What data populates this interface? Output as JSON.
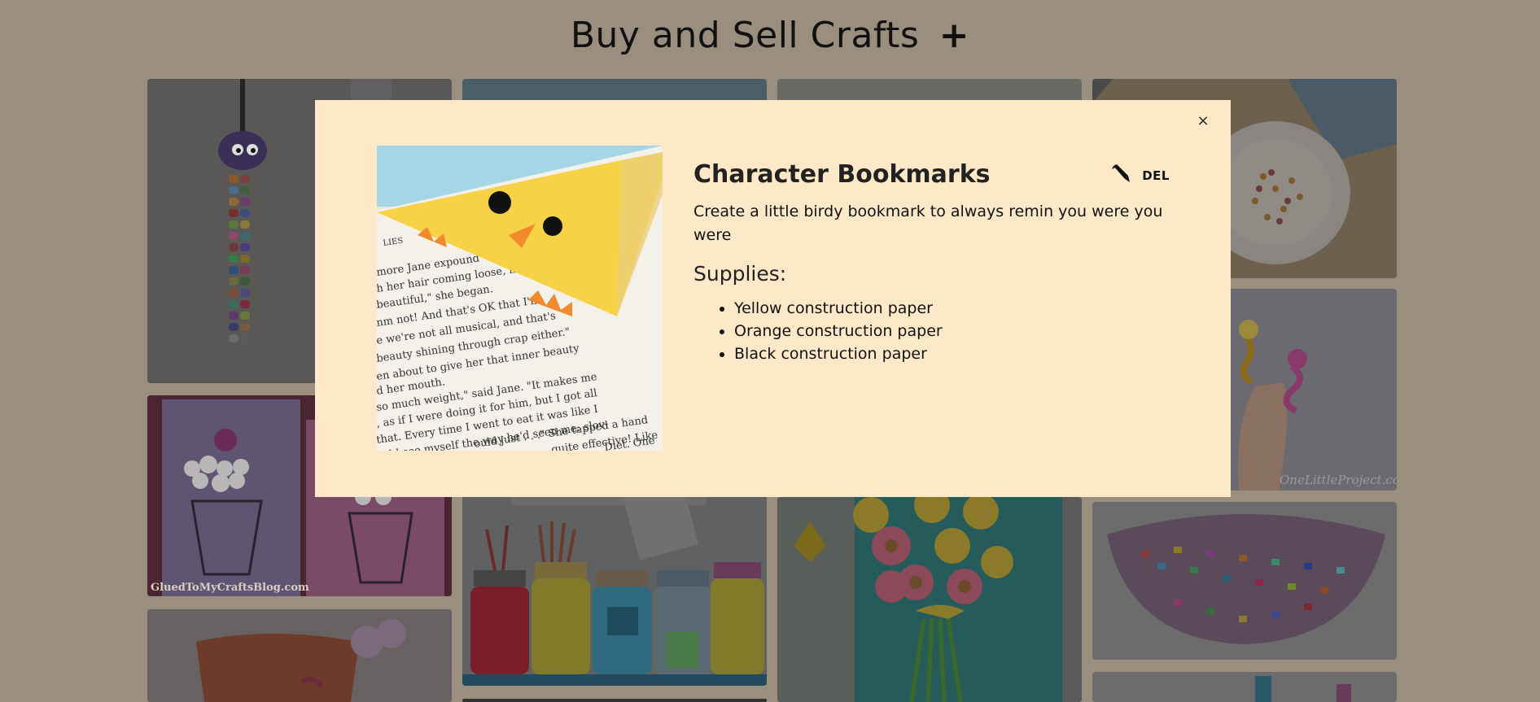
{
  "header": {
    "title": "Buy and Sell Crafts",
    "add_label": "+"
  },
  "gallery": {
    "watermark": "GluedToMyCraftsBlog.com",
    "watermark2": "OneLittleProject.com"
  },
  "modal": {
    "close_label": "×",
    "title": "Character Bookmarks",
    "delete_label": "DEL",
    "description": "Create a little birdy bookmark to always remin you were you were",
    "supplies_title": "Supplies:",
    "supplies": [
      "Yellow construction paper",
      "Orange construction paper",
      "Black construction paper"
    ],
    "book_lines": [
      "LIES",
      "more Jane expound",
      "h her hair coming loose, her",
      "beautiful,\" she began.",
      "nm not! And that's OK that I'm",
      "e we're not all musical, and that's",
      "beauty shining through crap either.\"",
      "en about to give her that inner beauty",
      "d her mouth.",
      "so much weight,\" said Jane. \"It makes me",
      ", as if I were doing it for him, but I got all",
      "that. Every time I went to eat it was like I",
      "ould see myself the way he'd seen me: slov-",
      "ould just . . .\" She tapped a hand",
      "quite effective! Like",
      "Diet. One"
    ]
  }
}
